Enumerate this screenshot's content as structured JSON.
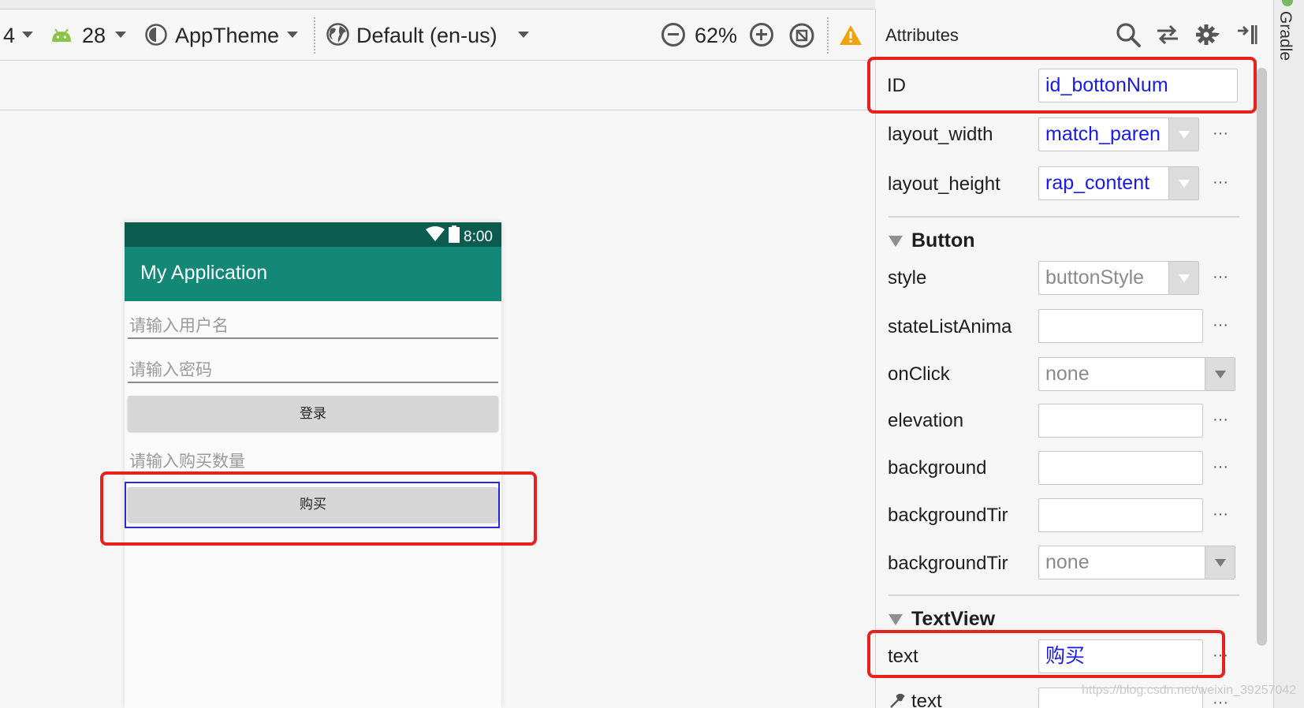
{
  "toolbar": {
    "api_prefix": "4",
    "api_level": "28",
    "theme": "AppTheme",
    "locale": "Default (en-us)",
    "zoom": "62%"
  },
  "phone": {
    "status_time": "8:00",
    "app_title": "My Application",
    "username_hint": "请输入用户名",
    "password_hint": "请输入密码",
    "login_button": "登录",
    "quantity_hint": "请输入购买数量",
    "buy_button": "购买"
  },
  "panel": {
    "title": "Attributes",
    "id_label": "ID",
    "id_value": "id_bottonNum",
    "layout_width_label": "layout_width",
    "layout_width_value": "match_paren",
    "layout_height_label": "layout_height",
    "layout_height_value": "rap_content",
    "button_section": "Button",
    "style_label": "style",
    "style_value": "buttonStyle",
    "state_list_label": "stateListAnima",
    "onclick_label": "onClick",
    "onclick_value": "none",
    "elevation_label": "elevation",
    "background_label": "background",
    "background_tint_label": "backgroundTir",
    "background_tint_mode_label": "backgroundTir",
    "background_tint_mode_value": "none",
    "textview_section": "TextView",
    "text_label": "text",
    "text_value": "购买",
    "text_tools_label": "text",
    "ellipsis": "···"
  },
  "side": {
    "gradle": "Gradle"
  },
  "watermark": "https://blog.csdn.net/weixin_39257042",
  "colors": {
    "status_bar": "#0b5c4f",
    "app_bar": "#138876",
    "highlight_red": "#e8211d",
    "selection_blue": "#2a2ad8",
    "value_blue": "#1a1ae6"
  }
}
